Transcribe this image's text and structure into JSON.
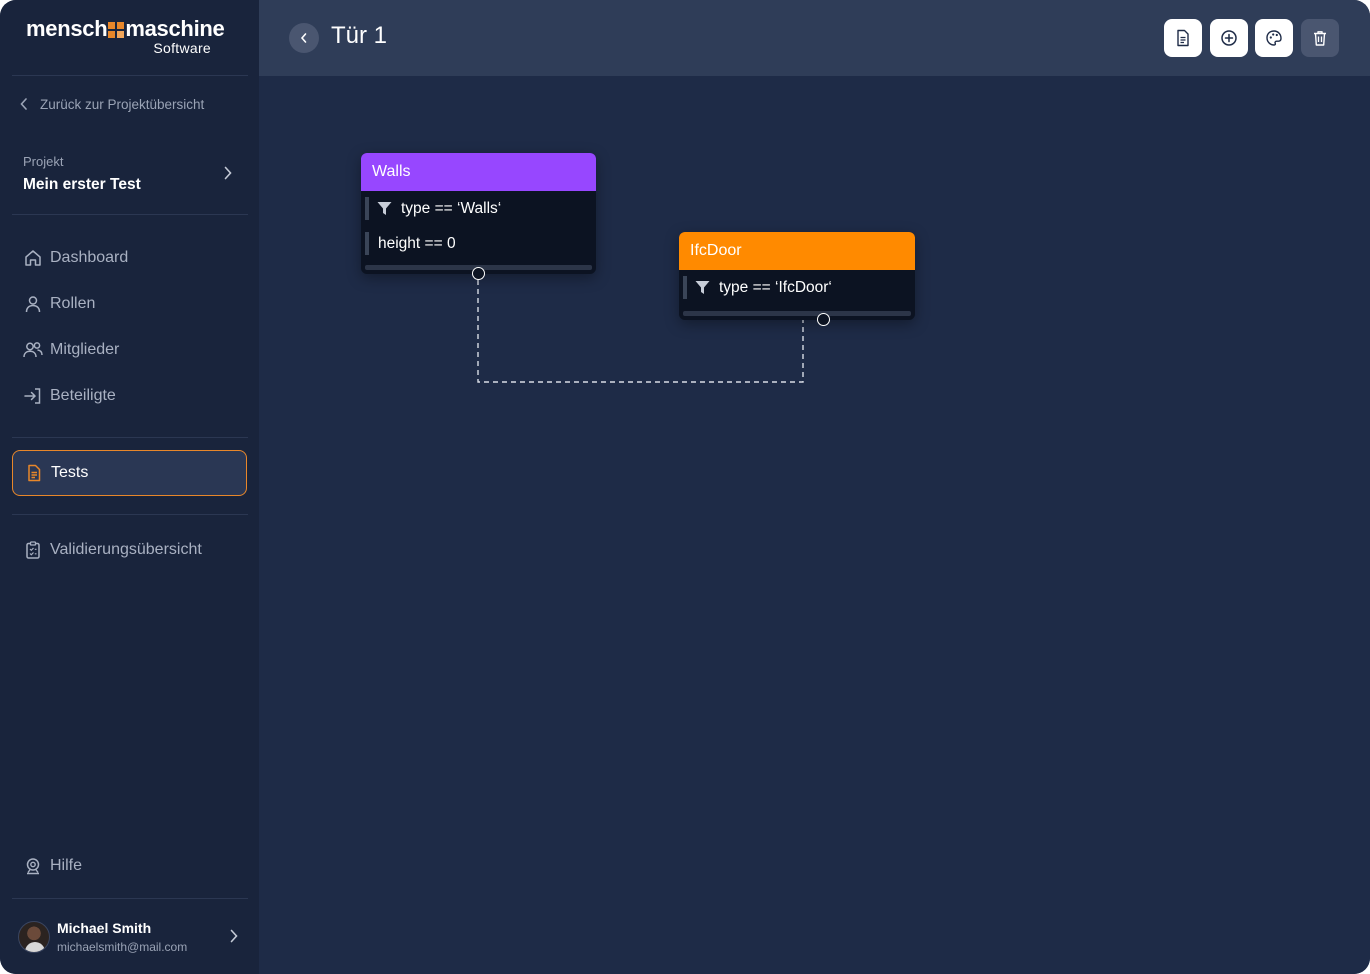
{
  "app": {
    "logo_main_left": "mensch",
    "logo_main_right": "maschine",
    "logo_sub": "Software",
    "logo_mark_color": "#e8872a"
  },
  "sidebar": {
    "back_label": "Zurück zur Projektübersicht",
    "project_label": "Projekt",
    "project_name": "Mein erster Test",
    "items": [
      {
        "label": "Dashboard",
        "icon": "home-icon"
      },
      {
        "label": "Rollen",
        "icon": "user-icon"
      },
      {
        "label": "Mitglieder",
        "icon": "users-icon"
      },
      {
        "label": "Beteiligte",
        "icon": "login-icon"
      },
      {
        "label": "Tests",
        "icon": "document-icon",
        "active": true
      },
      {
        "label": "Validierungsübersicht",
        "icon": "clipboard-check-icon"
      }
    ],
    "help_label": "Hilfe",
    "user": {
      "name": "Michael Smith",
      "email": "michaelsmith@mail.com"
    }
  },
  "header": {
    "title": "Tür 1",
    "tools": [
      {
        "name": "document-icon"
      },
      {
        "name": "add-circle-icon"
      },
      {
        "name": "palette-icon"
      },
      {
        "name": "trash-icon"
      }
    ]
  },
  "canvas": {
    "nodes": [
      {
        "title": "Walls",
        "color": "#9747ff",
        "rows": [
          {
            "text": "type == ‘Walls‘",
            "filter": true
          },
          {
            "text": "height == 0",
            "filter": false
          }
        ]
      },
      {
        "title": "IfcDoor",
        "color": "#ff8a00",
        "rows": [
          {
            "text": "type == ‘IfcDoor‘",
            "filter": true
          }
        ]
      }
    ],
    "connection_style": "dashed"
  },
  "colors": {
    "sidebar_bg": "#19243c",
    "canvas_bg": "#1e2b47",
    "header_bg": "#2f3d58",
    "accent": "#e8872a"
  }
}
